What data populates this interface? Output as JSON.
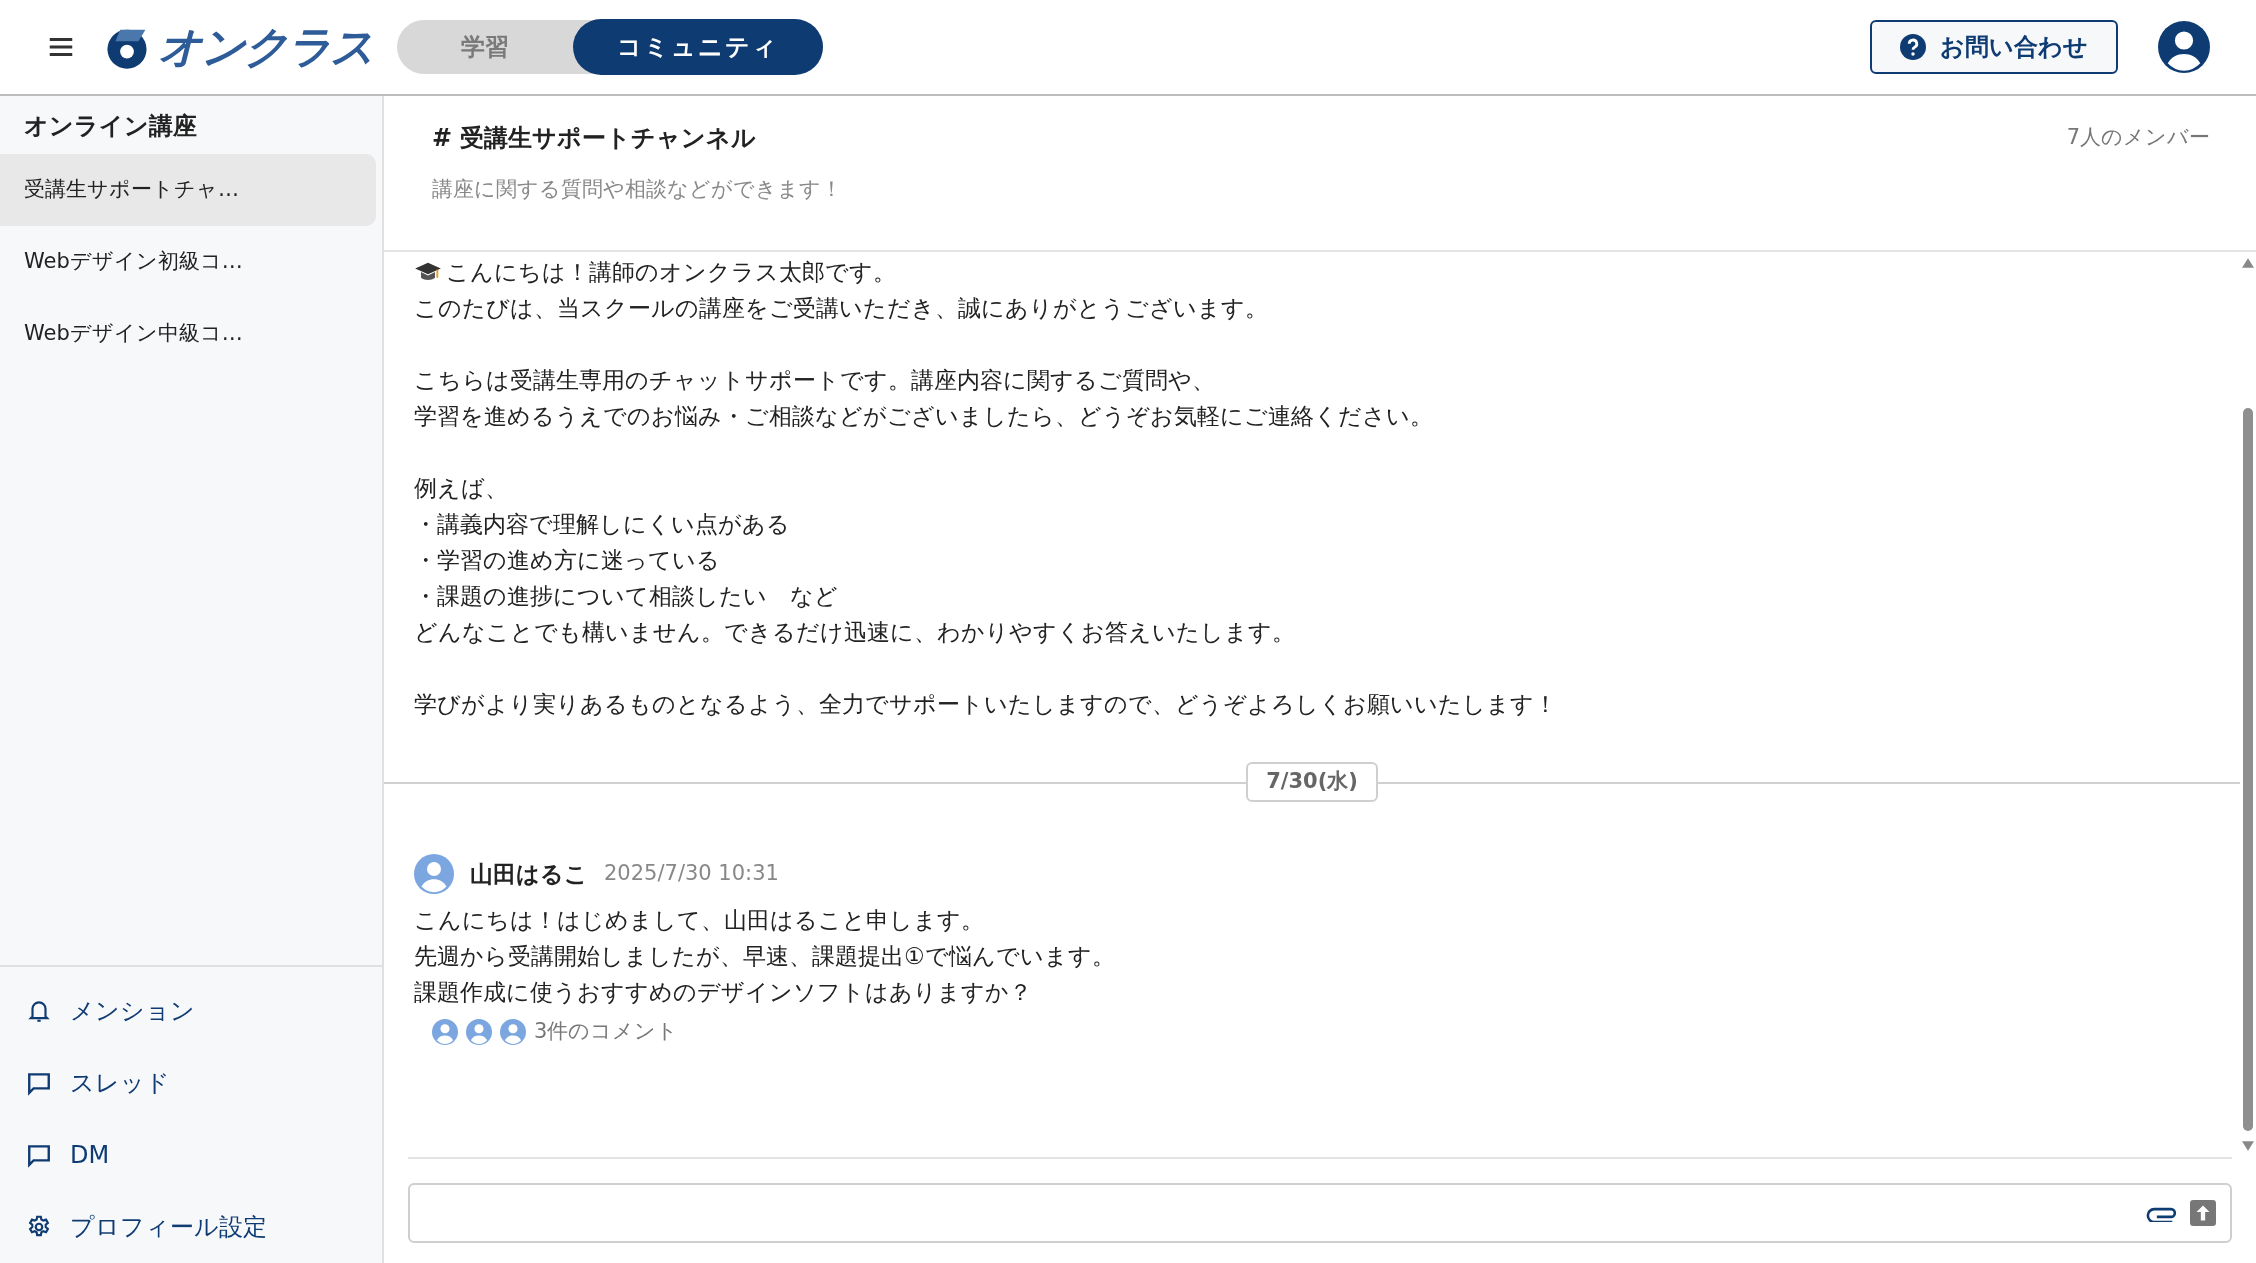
{
  "header": {
    "logo_text": "オンクラス",
    "tabs": [
      {
        "label": "学習",
        "selected": false
      },
      {
        "label": "コミュニティ",
        "selected": true
      }
    ],
    "help_button": "お問い合わせ"
  },
  "sidebar": {
    "section_title": "オンライン講座",
    "channels": [
      {
        "label": "受講生サポートチャ…",
        "selected": true
      },
      {
        "label": "Webデザイン初級コ…",
        "selected": false
      },
      {
        "label": "Webデザイン中級コ…",
        "selected": false
      }
    ],
    "nav": [
      {
        "kind": "bell",
        "label": "メンション"
      },
      {
        "kind": "chat",
        "label": "スレッド"
      },
      {
        "kind": "chat",
        "label": "DM"
      },
      {
        "kind": "gear",
        "label": "プロフィール設定"
      }
    ]
  },
  "channel": {
    "title": "# 受講生サポートチャンネル",
    "description": "講座に関する質問や相談などができます！",
    "members": "7人のメンバー"
  },
  "pinned_message": {
    "paragraphs": [
      [
        "こんにちは！講師のオンクラス太郎です。",
        "このたびは、当スクールの講座をご受講いただき、誠にありがとうございます。"
      ],
      [
        "こちらは受講生専用のチャットサポートです。講座内容に関するご質問や、",
        "学習を進めるうえでのお悩み・ご相談などがございましたら、どうぞお気軽にご連絡ください。"
      ],
      [
        "例えば、",
        "・講義内容で理解しにくい点がある",
        "・学習の進め方に迷っている",
        "・課題の進捗について相談したい　など",
        "どんなことでも構いません。できるだけ迅速に、わかりやすくお答えいたします。"
      ],
      [
        "学びがより実りあるものとなるよう、全力でサポートいたしますので、どうぞよろしくお願いいたします！"
      ]
    ]
  },
  "date_divider": "7/30(水)",
  "messages": [
    {
      "author": "山田はるこ",
      "time": "2025/7/30 10:31",
      "lines": [
        "こんにちは！はじめまして、山田はること申します。",
        "先週から受講開始しましたが、早速、課題提出①で悩んでいます。",
        "課題作成に使うおすすめのデザインソフトはありますか？"
      ],
      "comments": "3件のコメント"
    }
  ]
}
